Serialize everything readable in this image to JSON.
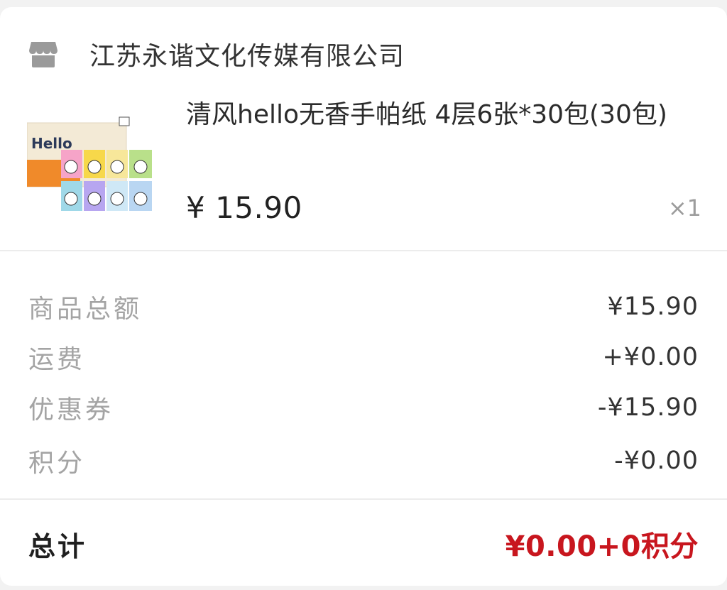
{
  "shop": {
    "icon": "store-icon",
    "name": "江苏永谐文化传媒有限公司"
  },
  "product": {
    "image_text": "Hello",
    "title": "清风hello无香手帕纸 4层6张*30包(30包)",
    "price": "¥ 15.90",
    "quantity": "×1"
  },
  "summary": [
    {
      "label": "商品总额",
      "value": "¥15.90"
    },
    {
      "label": "运费",
      "value": "+¥0.00"
    },
    {
      "label": "优惠券",
      "value": "-¥15.90"
    },
    {
      "label": "积分",
      "value": "-¥0.00"
    }
  ],
  "total": {
    "label": "总计",
    "value": "¥0.00+0积分"
  },
  "colors": {
    "total_red": "#c8161e",
    "background": "#f2f2f2"
  }
}
